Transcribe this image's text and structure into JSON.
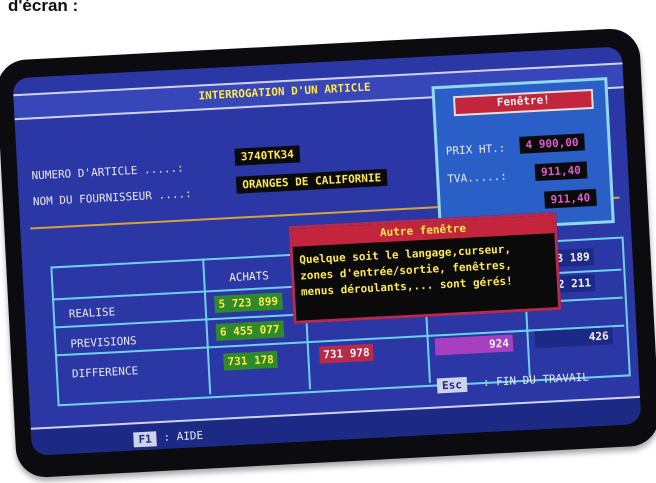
{
  "caption": "d'écran :",
  "screen": {
    "title": "INTERROGATION D'UN ARTICLE",
    "article_label": "NUMERO D'ARTICLE .....:",
    "article_value": "3740TK34",
    "supplier_label": "NOM DU FOURNISSEUR ....:",
    "supplier_value": "ORANGES DE CALIFORNIE",
    "table": {
      "col_achats": "ACHATS",
      "rows": [
        {
          "label": "REALISE",
          "c1": "5 723 899",
          "c4": "2 211"
        },
        {
          "label": "PREVISIONS",
          "c1": "6 455 077",
          "c4": "3 189"
        },
        {
          "label": "DIFFERENCE",
          "c1": "731 178",
          "c2": "731 978",
          "c3": "924",
          "c4": "426"
        }
      ]
    },
    "window1": {
      "title": "Fenêtre!",
      "prix_label": "PRIX HT.:",
      "prix_value": "4 900,00",
      "tva_label": "TVA.....:",
      "tva_value": "911,40",
      "extra_value": "911,40"
    },
    "window2": {
      "title": "Autre fenêtre",
      "text": "Quelque soit le langage,curseur,\nzones d'entrée/sortie, fenêtres,\nmenus déroulants,... sont gérés!"
    },
    "footer": {
      "esc_key": "Esc",
      "esc_text": ": FIN DU TRAVAIL",
      "f1_key": "F1",
      "f1_text": ": AIDE"
    }
  },
  "colors": {
    "screen_bg": "#2a37a5",
    "highlight_yellow": "#ffe94a",
    "window_red": "#c3263c",
    "cyan_border": "#6fd0ea"
  }
}
